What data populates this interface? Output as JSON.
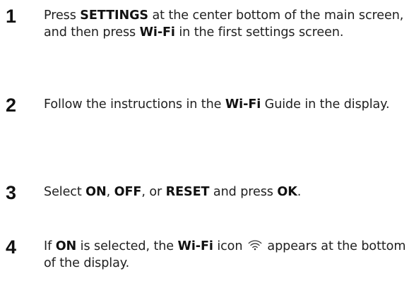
{
  "steps": [
    {
      "number": "1",
      "parts": {
        "a": "Press ",
        "b": "SETTINGS",
        "c": " at the center bottom of the main screen, and then press ",
        "d": "Wi-Fi",
        "e": " in the first settings screen."
      }
    },
    {
      "number": "2",
      "parts": {
        "a": "Follow the instructions in the ",
        "b": "Wi-Fi",
        "c": " Guide in the display."
      }
    },
    {
      "number": "3",
      "parts": {
        "a": "Select ",
        "b": "ON",
        "c": ", ",
        "d": "OFF",
        "e": ", or ",
        "f": "RESET",
        "g": " and press ",
        "h": "OK",
        "i": "."
      }
    },
    {
      "number": "4",
      "parts": {
        "a": "If ",
        "b": "ON",
        "c": " is selected, the ",
        "d": "Wi-Fi",
        "e": " icon ",
        "f": " appears at the bottom of the display."
      },
      "icon": "wifi-icon"
    }
  ]
}
